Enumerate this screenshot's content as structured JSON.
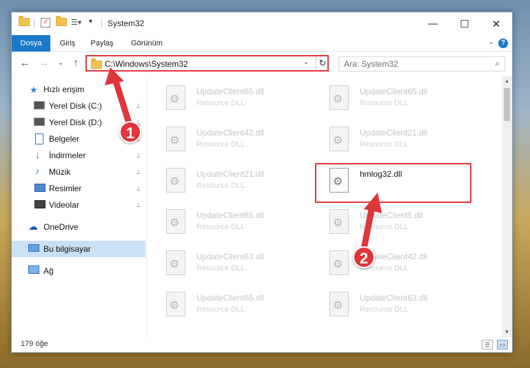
{
  "window": {
    "title": "System32",
    "controls": {
      "minimize": "—",
      "maximize": "☐",
      "close": "✕"
    }
  },
  "ribbon": {
    "tabs": [
      {
        "label": "Dosya",
        "active": true
      },
      {
        "label": "Giriş"
      },
      {
        "label": "Paylaş"
      },
      {
        "label": "Görünüm"
      }
    ],
    "help": "?"
  },
  "address": {
    "path": "C:\\Windows\\System32",
    "refresh": "↻",
    "dropdown": "⌄"
  },
  "search": {
    "placeholder": "Ara: System32",
    "icon": "⌕"
  },
  "nav": {
    "back": "←",
    "forward": "→",
    "recent": "⌄",
    "up": "↑"
  },
  "sidebar": {
    "items": [
      {
        "label": "Hızlı erişim",
        "icon": "star-icon"
      },
      {
        "label": "Yerel Disk (C:)",
        "icon": "drive-icon",
        "pinned": true
      },
      {
        "label": "Yerel Disk (D:)",
        "icon": "drive-icon",
        "pinned": true
      },
      {
        "label": "Belgeler",
        "icon": "documents-icon",
        "pinned": true
      },
      {
        "label": "İndirmeler",
        "icon": "downloads-icon",
        "pinned": true
      },
      {
        "label": "Müzik",
        "icon": "music-icon",
        "pinned": true
      },
      {
        "label": "Resimler",
        "icon": "pictures-icon",
        "pinned": true
      },
      {
        "label": "Videolar",
        "icon": "videos-icon",
        "pinned": true
      },
      {
        "label": "OneDrive",
        "icon": "cloud-icon"
      },
      {
        "label": "Bu bilgisayar",
        "icon": "computer-icon",
        "selected": true
      },
      {
        "label": "Ağ",
        "icon": "network-icon"
      }
    ],
    "pin_glyph": "📌"
  },
  "files": [
    {
      "name": "UpdateClient65.dll",
      "type": "Resource DLL"
    },
    {
      "name": "UpdateClient65.dll",
      "type": "Resource DLL"
    },
    {
      "name": "UpdateClient42.dll",
      "type": "Resource DLL"
    },
    {
      "name": "UpdateClient21.dll",
      "type": "Resource DLL"
    },
    {
      "name": "UpdateClient21.dll",
      "type": "Resource DLL"
    },
    {
      "name": "hmlog32.dll",
      "type": "",
      "highlighted": true
    },
    {
      "name": "UpdateClient65.dll",
      "type": "Resource DLL"
    },
    {
      "name": "UpdateClient5.dll",
      "type": "Resource DLL"
    },
    {
      "name": "UpdateClient63.dll",
      "type": "Resource DLL"
    },
    {
      "name": "UpdateClient42.dll",
      "type": "Resource DLL"
    },
    {
      "name": "UpdateClient65.dll",
      "type": "Resource DLL"
    },
    {
      "name": "UpdateClient63.dll",
      "type": "Resource DLL"
    }
  ],
  "status": {
    "count": "179 öğe"
  },
  "callouts": [
    "1",
    "2"
  ],
  "colors": {
    "accent": "#1979ca",
    "annotation": "#e0353a",
    "selected": "#cce0f4"
  }
}
